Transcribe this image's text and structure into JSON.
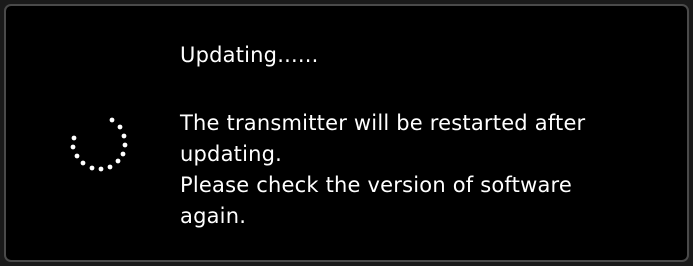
{
  "dialog": {
    "status": "Updating......",
    "message_lines": [
      "The transmitter will be restarted after",
      "updating.",
      "Please check the version of software",
      "again."
    ],
    "spinner_icon": "loading-spinner-icon",
    "text_color": "#ffffff",
    "background_color": "#000000"
  }
}
